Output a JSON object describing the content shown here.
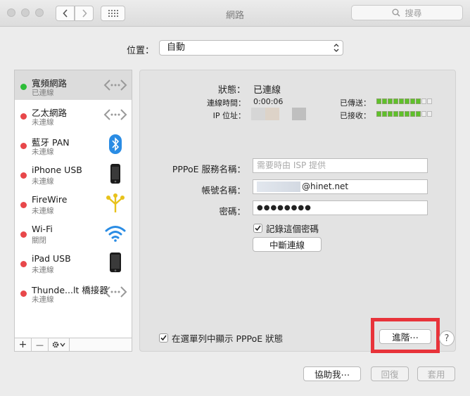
{
  "window": {
    "title": "網路",
    "search_placeholder": "搜尋"
  },
  "location": {
    "label": "位置：",
    "value": "自動"
  },
  "services": [
    {
      "name": "寬頻網路",
      "status": "已連線",
      "status_color": "#2dbd38",
      "icon": "ppp-arrows-icon",
      "selected": true
    },
    {
      "name": "乙太網路",
      "status": "未連線",
      "status_color": "#e8474a",
      "icon": "ethernet-arrows-icon"
    },
    {
      "name": "藍牙 PAN",
      "status": "未連線",
      "status_color": "#e8474a",
      "icon": "bluetooth-icon"
    },
    {
      "name": "iPhone USB",
      "status": "未連線",
      "status_color": "#e8474a",
      "icon": "iphone-icon"
    },
    {
      "name": "FireWire",
      "status": "未連線",
      "status_color": "#e8474a",
      "icon": "firewire-icon"
    },
    {
      "name": "Wi-Fi",
      "status": "關閉",
      "status_color": "#e8474a",
      "icon": "wifi-icon"
    },
    {
      "name": "iPad USB",
      "status": "未連線",
      "status_color": "#e8474a",
      "icon": "ipad-icon"
    },
    {
      "name": "Thunde...lt 橋接器",
      "status": "未連線",
      "status_color": "#e8474a",
      "icon": "thunderbolt-bridge-icon"
    }
  ],
  "sidebar_tools": {
    "add": "+",
    "remove": "—",
    "action": "gear-icon"
  },
  "status": {
    "label": "狀態：",
    "value": "已連線",
    "connect_time_label": "連線時間：",
    "connect_time": "0:00:06",
    "ip_label": "IP 位址：",
    "sent_label": "已傳送：",
    "received_label": "已接收：",
    "sent_level": 0.8,
    "received_level": 0.8
  },
  "form": {
    "service_name_label": "PPPoE 服務名稱：",
    "service_name_placeholder": "需要時由 ISP 提供",
    "account_label": "帳號名稱：",
    "account_value": "@hinet.net",
    "password_label": "密碼：",
    "password_value": "●●●●●●●●",
    "remember_label": "記錄這個密碼",
    "disconnect_button": "中斷連線"
  },
  "show_status_label": "在選單列中顯示 PPPoE 狀態",
  "advanced_button": "進階⋯",
  "help": "?",
  "bottom": {
    "assist": "協助我⋯",
    "revert": "回復",
    "apply": "套用"
  },
  "colors": {
    "connected": "#2dbd38",
    "disconnected": "#e8474a",
    "highlight_box": "#e8333a",
    "level_on": "#5ec12a"
  }
}
